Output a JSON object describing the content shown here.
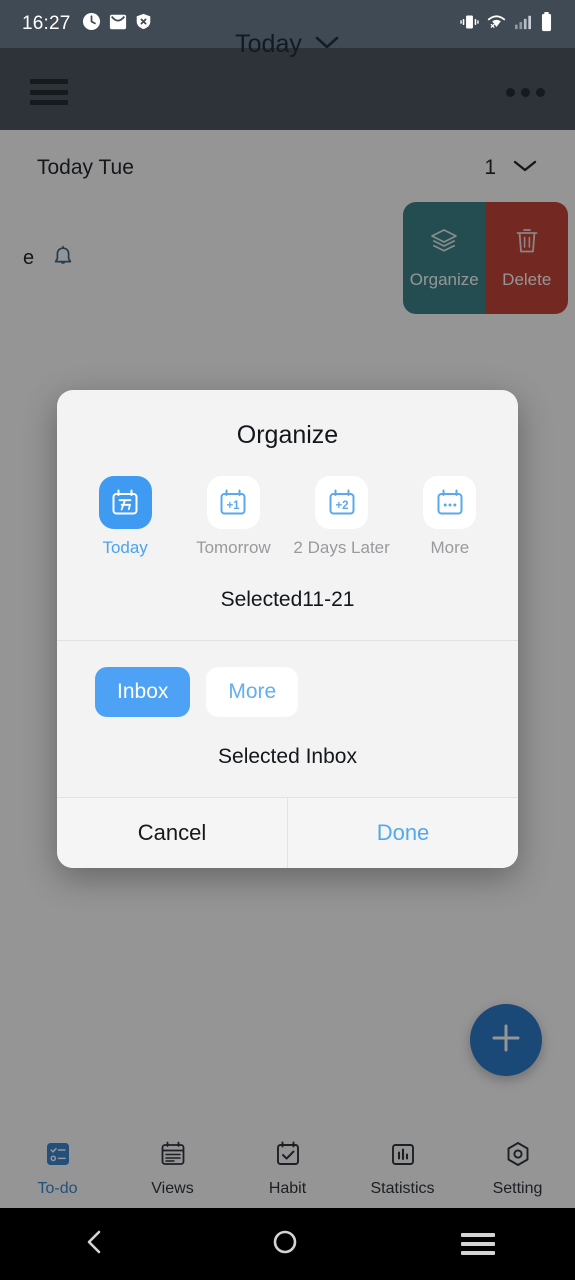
{
  "status_bar": {
    "time": "16:27",
    "left_icons": [
      "clock-icon",
      "mail-icon",
      "shield-icon"
    ],
    "right_icons": [
      "vibrate-icon",
      "wifi-icon",
      "signal-icon",
      "battery-icon"
    ]
  },
  "app_bar": {
    "menu_icon": "hamburger-menu-icon",
    "title": "Today",
    "dropdown_icon": "chevron-down-icon",
    "overflow_icon": "more-options-icon"
  },
  "list": {
    "section_title": "Today Tue",
    "section_count": "1",
    "collapse_icon": "chevron-down-icon",
    "task_partial_text": "e",
    "task_reminder_icon": "bell-icon",
    "swipe_actions": [
      {
        "label": "Organize",
        "icon": "layers-icon",
        "color": "#2f7b84"
      },
      {
        "label": "Delete",
        "icon": "trash-icon",
        "color": "#c0392b"
      }
    ]
  },
  "fab": {
    "icon": "plus-icon",
    "color": "#1e74c8"
  },
  "tabs": [
    {
      "label": "To-do",
      "icon": "checklist-icon",
      "active": true
    },
    {
      "label": "Views",
      "icon": "calendar-icon",
      "active": false
    },
    {
      "label": "Habit",
      "icon": "check-square-icon",
      "active": false
    },
    {
      "label": "Statistics",
      "icon": "bar-chart-icon",
      "active": false
    },
    {
      "label": "Setting",
      "icon": "gear-hexagon-icon",
      "active": false
    }
  ],
  "nav_bar": {
    "back_icon": "back-chevron-icon",
    "home_icon": "home-circle-icon",
    "recents_icon": "recents-icon"
  },
  "dialog": {
    "title": "Organize",
    "date_options": [
      {
        "label": "Today",
        "icon": "calendar-today-icon",
        "badge": "今",
        "selected": true
      },
      {
        "label": "Tomorrow",
        "icon": "calendar-plus-1-icon",
        "badge": "+1",
        "selected": false
      },
      {
        "label": "2 Days Later",
        "icon": "calendar-plus-2-icon",
        "badge": "+2",
        "selected": false
      },
      {
        "label": "More",
        "icon": "calendar-more-icon",
        "badge": "•••",
        "selected": false
      }
    ],
    "selected_date_text": "Selected11-21",
    "list_options": [
      {
        "label": "Inbox",
        "selected": true
      },
      {
        "label": "More",
        "selected": false
      }
    ],
    "selected_list_text": "Selected  Inbox",
    "cancel_label": "Cancel",
    "done_label": "Done",
    "accent_color": "#4da2f5"
  }
}
